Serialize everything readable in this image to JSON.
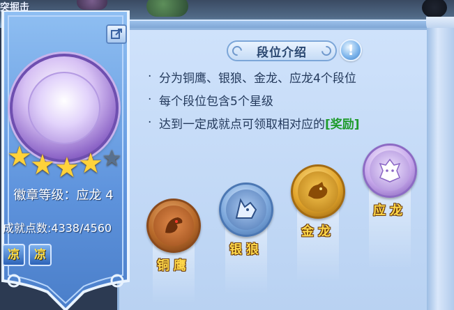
{
  "top_left_text": "突掘击",
  "panel": {
    "title": "段位介绍",
    "info_glyph": "!",
    "bullets": [
      {
        "dot": "·",
        "text": "分为铜鹰、银狼、金龙、应龙4个段位"
      },
      {
        "dot": "·",
        "text": "每个段位包含5个星级"
      },
      {
        "dot": "·",
        "text": "达到一定成就点可领取相对应的",
        "reward": "[奖励]"
      }
    ]
  },
  "ranks": [
    {
      "label": "铜鹰",
      "emblem": "eagle-icon"
    },
    {
      "label": "银狼",
      "emblem": "wolf-icon"
    },
    {
      "label": "金龙",
      "emblem": "gold-dragon-icon"
    },
    {
      "label": "应龙",
      "emblem": "ying-dragon-icon"
    }
  ],
  "badge": {
    "level_text": "徽章等级：应龙 4",
    "stars_total": 5,
    "stars_filled": 4,
    "points_text": "成就点数:4338/4560",
    "tags": [
      "凉",
      "凉"
    ]
  },
  "colors": {
    "reward_green": "#1f9b2c",
    "label_gold": "#ffd84a",
    "star_gold": "#ffd23a"
  }
}
